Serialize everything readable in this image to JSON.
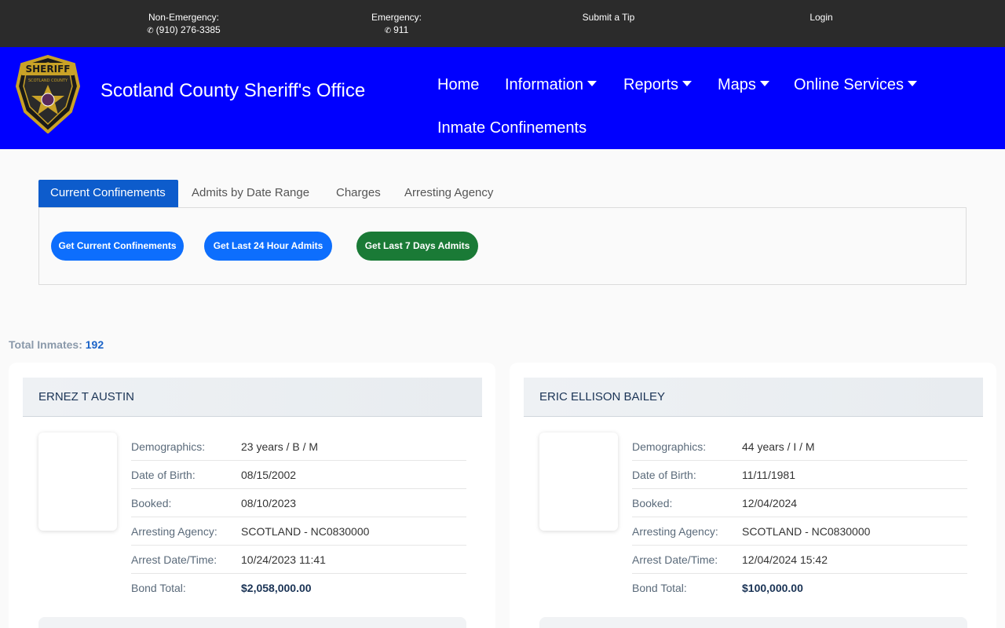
{
  "topbar": {
    "non_emergency_label": "Non-Emergency:",
    "non_emergency_phone": "(910) 276-3385",
    "emergency_label": "Emergency:",
    "emergency_phone": "911",
    "submit_tip": "Submit a Tip",
    "login": "Login"
  },
  "header": {
    "logo_text": "SHERIFF",
    "logo_subtext": "SCOTLAND COUNTY",
    "title": "Scotland County Sheriff's Office",
    "nav": {
      "home": "Home",
      "information": "Information",
      "reports": "Reports",
      "maps": "Maps",
      "online_services": "Online Services",
      "inmate_confinements": "Inmate Confinements"
    }
  },
  "tabs": {
    "current": "Current Confinements",
    "admits_range": "Admits by Date Range",
    "charges": "Charges",
    "arresting_agency": "Arresting Agency"
  },
  "buttons": {
    "current": "Get Current Confinements",
    "last24": "Get Last 24 Hour Admits",
    "last7": "Get Last 7 Days Admits"
  },
  "total": {
    "label": "Total Inmates:",
    "value": "192"
  },
  "field_labels": {
    "demographics": "Demographics:",
    "dob": "Date of Birth:",
    "booked": "Booked:",
    "agency": "Arresting Agency:",
    "arrest_dt": "Arrest Date/Time:",
    "bond": "Bond Total:"
  },
  "inmates": [
    {
      "name": "ERNEZ T AUSTIN",
      "demographics": "23 years / B / M",
      "dob": "08/15/2002",
      "booked": "08/10/2023",
      "agency": "SCOTLAND - NC0830000",
      "arrest_dt": "10/24/2023 11:41",
      "bond": "$2,058,000.00"
    },
    {
      "name": "ERIC ELLISON BAILEY",
      "demographics": "44 years / I / M",
      "dob": "11/11/1981",
      "booked": "12/04/2024",
      "agency": "SCOTLAND - NC0830000",
      "arrest_dt": "12/04/2024 15:42",
      "bond": "$100,000.00"
    }
  ],
  "colors": {
    "topbar": "#2b2b2b",
    "header": "#0000ff",
    "active_tab": "#0d5ccc",
    "button_blue": "#0d6efd",
    "button_green": "#1a7a36"
  }
}
